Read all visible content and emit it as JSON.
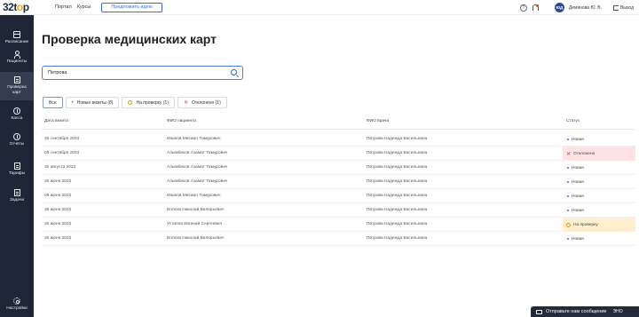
{
  "topbar": {
    "logo_main": "32t",
    "logo_accent": "o",
    "logo_end": "p",
    "nav": [
      "Портал",
      "Курсы"
    ],
    "suggest_button": "Предложить идею",
    "user_initials": "ЮД",
    "user_name": "Демянова Ю. В.",
    "logout": "Выход"
  },
  "sidebar": {
    "items": [
      {
        "label": "Расписание",
        "icon": "calendar-icon"
      },
      {
        "label": "Пациенты",
        "icon": "person-icon"
      },
      {
        "label": "Проверка карт",
        "icon": "document-icon"
      },
      {
        "label": "Касса",
        "icon": "cash-icon"
      },
      {
        "label": "Отчёты",
        "icon": "report-icon"
      },
      {
        "label": "Тарифы",
        "icon": "tariff-icon"
      },
      {
        "label": "Задачи",
        "icon": "tasks-icon"
      },
      {
        "label": "Настройки",
        "icon": "gear-icon"
      }
    ]
  },
  "page": {
    "title": "Проверка медицинских карт",
    "search_value": "Петрова"
  },
  "filters": [
    {
      "label": "Все",
      "kind": "all"
    },
    {
      "label": "Новые визиты (8)",
      "kind": "new"
    },
    {
      "label": "На проверку (1)",
      "kind": "review"
    },
    {
      "label": "Отклонено (1)",
      "kind": "rejected"
    }
  ],
  "table": {
    "headers": {
      "date": "Дата визита",
      "patient": "ФИО пациента",
      "doctor": "ФИО врача",
      "status": "Статус"
    },
    "rows": [
      {
        "date": "25 сентября 2023",
        "patient": "Иванов Михаил Тимурович",
        "doctor": "Петрова Надежда Васильевна",
        "status": "Новая",
        "kind": "new"
      },
      {
        "date": "05 сентября 2023",
        "patient": "Алымбеков Азамат Тимурович",
        "doctor": "Петрова Надежда Васильевна",
        "status": "Отклонено",
        "kind": "rejected"
      },
      {
        "date": "30 августа 2023",
        "patient": "Алымбеков Азамат Тимурович",
        "doctor": "Петрова Надежда Васильевна",
        "status": "Новая",
        "kind": "new"
      },
      {
        "date": "26 июня 2023",
        "patient": "Алымбеков Азамат Тимурович",
        "doctor": "Петрова Надежда Васильевна",
        "status": "Новая",
        "kind": "new"
      },
      {
        "date": "09 июня 2023",
        "patient": "Иванов Михаил Тимурович",
        "doctor": "Петрова Надежда Васильевна",
        "status": "Новая",
        "kind": "new"
      },
      {
        "date": "29 июня 2023",
        "patient": "Волков Николай Валерьевич",
        "doctor": "Петрова Надежда Васильевна",
        "status": "Новая",
        "kind": "new"
      },
      {
        "date": "26 июня 2023",
        "patient": "Устинов Евгений Сергеевич",
        "doctor": "Петрова Надежда Васильевна",
        "status": "На проверку",
        "kind": "review"
      },
      {
        "date": "26 июня 2023",
        "patient": "Волков Николай Валерьевич",
        "doctor": "Петрова Надежда Васильевна",
        "status": "Новая",
        "kind": "new"
      }
    ]
  },
  "chat": {
    "label": "Отправьте нам сообщение",
    "extra": "ЭНО"
  },
  "colors": {
    "sidebar_bg": "#1f2635",
    "accent": "#3c6fd1",
    "rejected_bg": "#fde3e3",
    "review_bg": "#fdefcf"
  }
}
